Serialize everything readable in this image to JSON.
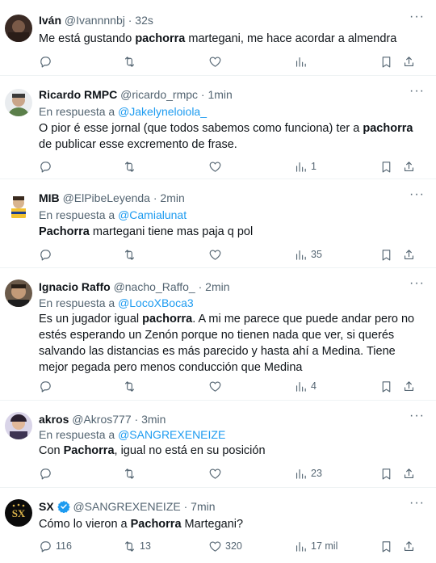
{
  "posts": [
    {
      "name": "Iván",
      "handle": "@Ivannnnbj",
      "time": "32s",
      "reply_label": "",
      "reply_to": "",
      "body_parts": [
        "Me está gustando ",
        "pachorra",
        " martegani, me hace acordar a almendra"
      ],
      "counts": {
        "reply": "",
        "repost": "",
        "like": "",
        "views": ""
      }
    },
    {
      "name": "Ricardo RMPC",
      "handle": "@ricardo_rmpc",
      "time": "1min",
      "reply_label": "En respuesta a ",
      "reply_to": "@Jakelyneloiola_",
      "body_parts": [
        "O pior é esse jornal (que todos sabemos como funciona) ter a ",
        "pachorra",
        " de publicar esse excremento de frase."
      ],
      "counts": {
        "reply": "",
        "repost": "",
        "like": "",
        "views": "1"
      }
    },
    {
      "name": "MIB",
      "handle": "@ElPibeLeyenda",
      "time": "2min",
      "reply_label": "En respuesta a ",
      "reply_to": "@Camialunat",
      "body_parts": [
        "",
        "Pachorra",
        " martegani tiene mas paja q pol"
      ],
      "counts": {
        "reply": "",
        "repost": "",
        "like": "",
        "views": "35"
      }
    },
    {
      "name": "Ignacio Raffo",
      "handle": "@nacho_Raffo_",
      "time": "2min",
      "reply_label": "En respuesta a ",
      "reply_to": "@LocoXBoca3",
      "body_parts": [
        "Es un jugador igual ",
        "pachorra",
        ". A mi me parece que puede andar pero no estés esperando un Zenón porque no tienen nada que ver, si querés salvando las distancias es más parecido y hasta ahí a Medina. Tiene mejor pegada pero menos conducción que Medina"
      ],
      "counts": {
        "reply": "",
        "repost": "",
        "like": "",
        "views": "4"
      }
    },
    {
      "name": "akros",
      "handle": "@Akros777",
      "time": "3min",
      "reply_label": "En respuesta a ",
      "reply_to": "@SANGREXENEIZE",
      "body_parts": [
        "Con ",
        "Pachorra",
        ", igual no está en su posición"
      ],
      "counts": {
        "reply": "",
        "repost": "",
        "like": "",
        "views": "23"
      }
    },
    {
      "name": "SX",
      "handle": "@SANGREXENEIZE",
      "time": "7min",
      "reply_label": "",
      "reply_to": "",
      "body_parts": [
        "Cómo lo vieron a ",
        "Pachorra",
        " Martegani?"
      ],
      "counts": {
        "reply": "116",
        "repost": "13",
        "like": "320",
        "views": "17 mil"
      }
    }
  ],
  "ui": {
    "dot": "·",
    "more": "···",
    "avatar_sx_text": "SX"
  },
  "colors": {
    "link": "#1d9bf0",
    "muted": "#536471",
    "text": "#0f1419",
    "verified": "#1d9bf0"
  },
  "icons": [
    "reply-icon",
    "repost-icon",
    "like-icon",
    "views-icon",
    "bookmark-icon",
    "share-icon",
    "more-icon",
    "verified-badge-icon"
  ]
}
